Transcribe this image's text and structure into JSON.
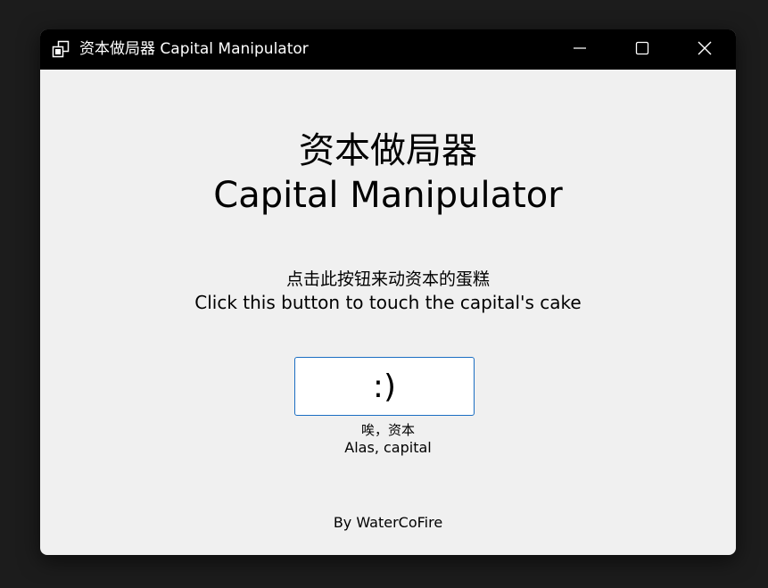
{
  "window": {
    "title": "资本做局器 Capital Manipulator",
    "controls": {
      "minimize_icon": "minimize-icon",
      "maximize_icon": "maximize-icon",
      "close_icon": "close-icon"
    }
  },
  "main": {
    "heading_cn": "资本做局器",
    "heading_en": "Capital Manipulator",
    "instruction_cn": "点击此按钮来动资本的蛋糕",
    "instruction_en": "Click this button to touch the capital's cake",
    "button_label": ":)",
    "caption_cn": "唉，资本",
    "caption_en": "Alas, capital",
    "footer": "By WaterCoFire"
  },
  "colors": {
    "titlebar": "#000000",
    "client_background": "#f0f0f0",
    "button_border": "#1b6ec2",
    "desktop": "#1c1c1c"
  }
}
